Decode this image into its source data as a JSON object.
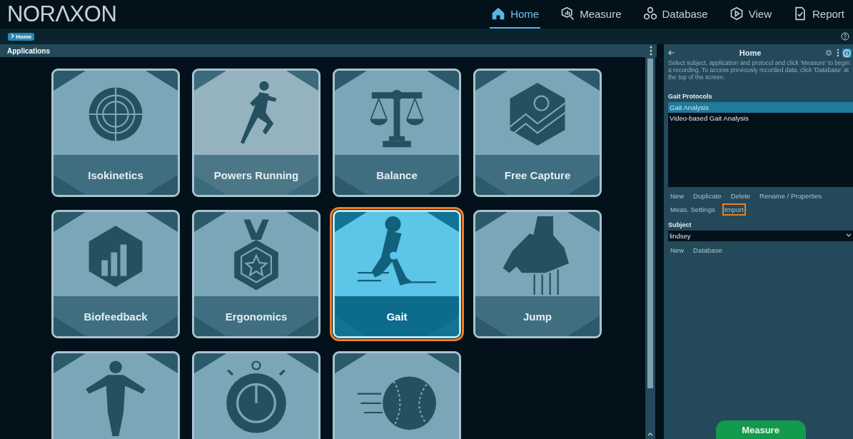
{
  "logo": "NORΛXON",
  "nav": [
    {
      "label": "Home",
      "kind": "home",
      "selected": true
    },
    {
      "label": "Measure",
      "kind": "measure",
      "selected": false
    },
    {
      "label": "Database",
      "kind": "database",
      "selected": false
    },
    {
      "label": "View",
      "kind": "view",
      "selected": false
    },
    {
      "label": "Report",
      "kind": "report",
      "selected": false
    }
  ],
  "breadcrumb": [
    {
      "label": "Home"
    }
  ],
  "applications": {
    "title": "Applications",
    "tiles": [
      {
        "label": "Isokinetics",
        "kind": "target",
        "selected": false,
        "hover": false
      },
      {
        "label": "Powers Running",
        "kind": "runner",
        "selected": false,
        "hover": true
      },
      {
        "label": "Balance",
        "kind": "scale",
        "selected": false,
        "hover": false
      },
      {
        "label": "Free Capture",
        "kind": "capture",
        "selected": false,
        "hover": false
      },
      {
        "label": "Biofeedback",
        "kind": "bars",
        "selected": false,
        "hover": false
      },
      {
        "label": "Ergonomics",
        "kind": "medal",
        "selected": false,
        "hover": false
      },
      {
        "label": "Gait",
        "kind": "gait",
        "selected": true,
        "hover": false
      },
      {
        "label": "Jump",
        "kind": "shoe",
        "selected": false,
        "hover": false
      },
      {
        "kind": "body",
        "selected": false,
        "hover": false
      },
      {
        "kind": "stopwatch",
        "selected": false,
        "hover": false
      },
      {
        "kind": "ball",
        "selected": false,
        "hover": false
      }
    ]
  },
  "panel": {
    "title": "Home",
    "description": "Select subject, application and protocol and click 'Measure' to begin a recording. To access previously recorded data, click 'Database' at the top of the screen.",
    "protocols": {
      "label": "Gait Protocols",
      "items": [
        {
          "label": "Gait Analysis",
          "selected": true
        },
        {
          "label": "Video-based Gait Analysis",
          "selected": false
        }
      ],
      "actions": [
        {
          "label": "New",
          "highlighted": false
        },
        {
          "label": "Duplicate",
          "highlighted": false
        },
        {
          "label": "Delete",
          "highlighted": false
        },
        {
          "label": "Rename / Properties",
          "highlighted": false
        },
        {
          "label": "Meas. Settings",
          "highlighted": false
        },
        {
          "label": "Import",
          "highlighted": true
        }
      ]
    },
    "subject": {
      "label": "Subject",
      "value": "lindsey",
      "actions": [
        "New",
        "Database"
      ]
    },
    "measure_button": "Measure"
  }
}
